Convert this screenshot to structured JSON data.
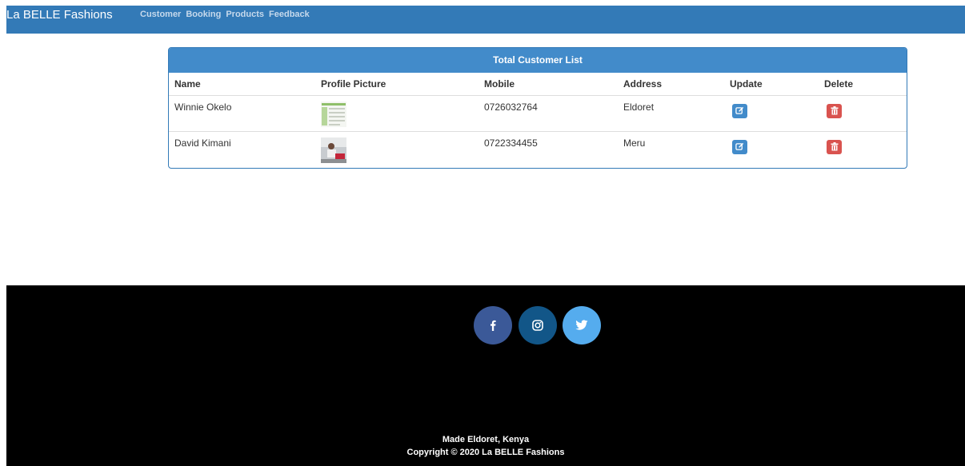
{
  "navbar": {
    "brand": "La BELLE Fashions",
    "links": [
      "Customer",
      "Booking",
      "Products",
      "Feedback"
    ]
  },
  "panel": {
    "title": "Total Customer List",
    "columns": [
      "Name",
      "Profile Picture",
      "Mobile",
      "Address",
      "Update",
      "Delete"
    ],
    "rows": [
      {
        "name": "Winnie Okelo",
        "mobile": "0726032764",
        "address": "Eldoret"
      },
      {
        "name": "David Kimani",
        "mobile": "0722334455",
        "address": "Meru"
      }
    ]
  },
  "icons": {
    "update": "edit-icon",
    "delete": "trash-icon",
    "facebook": "facebook-icon",
    "instagram": "instagram-icon",
    "twitter": "twitter-icon"
  },
  "colors": {
    "navbar": "#337ab7",
    "panel_heading": "#428bca",
    "update_button": "#428bca",
    "delete_button": "#d9534f",
    "footer": "#000000",
    "facebook": "#3b5998",
    "instagram": "#125688",
    "twitter": "#55acee"
  },
  "footer": {
    "made": "Made Eldoret, Kenya",
    "copyright": "Copyright © 2020 La BELLE Fashions"
  }
}
